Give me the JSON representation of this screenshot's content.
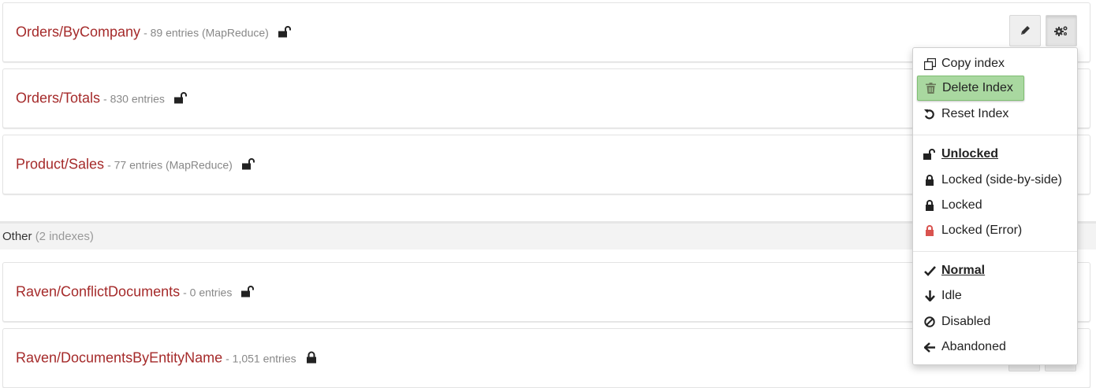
{
  "indexes": [
    {
      "name": "Orders/ByCompany",
      "meta": "- 89 entries (MapReduce)",
      "lock": "unlocked"
    },
    {
      "name": "Orders/Totals",
      "meta": "- 830 entries",
      "lock": "unlocked"
    },
    {
      "name": "Product/Sales",
      "meta": "- 77 entries (MapReduce)",
      "lock": "unlocked"
    }
  ],
  "other_section": {
    "label": "Other",
    "count": "(2 indexes)"
  },
  "other_indexes": [
    {
      "name": "Raven/ConflictDocuments",
      "meta": "- 0 entries",
      "lock": "unlocked"
    },
    {
      "name": "Raven/DocumentsByEntityName",
      "meta": "- 1,051 entries",
      "lock": "locked"
    }
  ],
  "toolbar": {
    "edit_icon": "pencil-icon",
    "settings_icon": "cogs-icon"
  },
  "menu": {
    "actions": [
      {
        "label": "Copy index",
        "icon": "copy-icon"
      },
      {
        "label": "Delete Index",
        "icon": "trash-icon",
        "highlighted": true
      },
      {
        "label": "Reset Index",
        "icon": "reset-icon"
      }
    ],
    "locks": [
      {
        "label": "Unlocked",
        "icon": "unlock-icon",
        "selected": true
      },
      {
        "label": "Locked (side-by-side)",
        "icon": "lock-icon"
      },
      {
        "label": "Locked",
        "icon": "lock-icon"
      },
      {
        "label": "Locked (Error)",
        "icon": "lock-error-icon",
        "color": "#d9534f"
      }
    ],
    "priorities": [
      {
        "label": "Normal",
        "icon": "check-icon",
        "selected": true
      },
      {
        "label": "Idle",
        "icon": "arrow-down-icon"
      },
      {
        "label": "Disabled",
        "icon": "ban-icon"
      },
      {
        "label": "Abandoned",
        "icon": "arrow-left-icon"
      }
    ]
  },
  "colors": {
    "index_name": "#a52a2a",
    "highlight": "#a9d8a0",
    "error": "#d9534f"
  }
}
